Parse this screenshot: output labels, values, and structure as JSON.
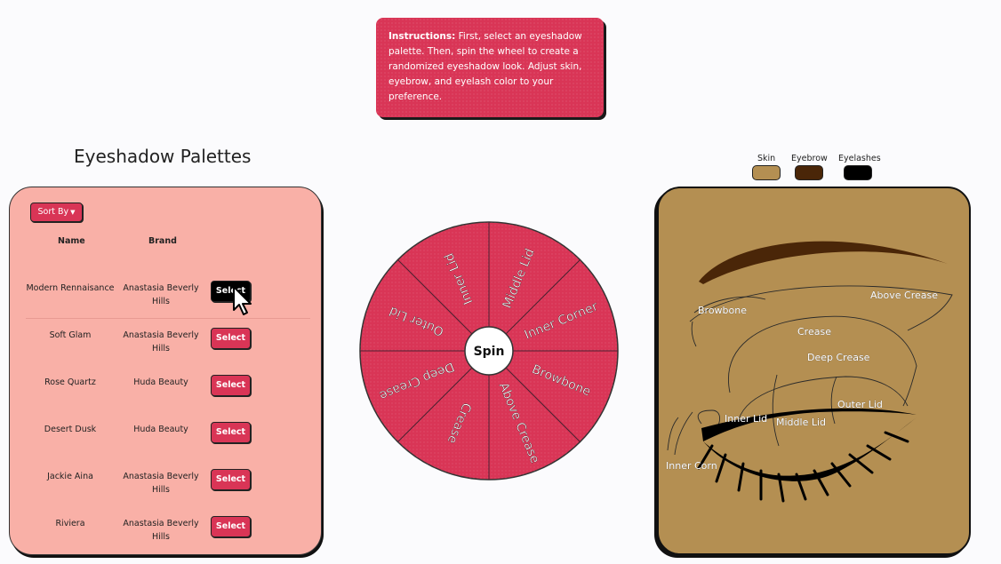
{
  "instructions": {
    "label": "Instructions:",
    "text": "First, select an eyeshadow palette. Then, spin the wheel to create a randomized eyeshadow look. Adjust skin, eyebrow, and eyelash color to your preference."
  },
  "palettes": {
    "title": "Eyeshadow Palettes",
    "sort_label": "Sort By",
    "headers": {
      "name": "Name",
      "brand": "Brand"
    },
    "select_label": "Select",
    "rows": [
      {
        "name": "Modern Rennaisance",
        "brand": "Anastasia Beverly Hills",
        "active": true
      },
      {
        "name": "Soft Glam",
        "brand": "Anastasia Beverly Hills",
        "active": false
      },
      {
        "name": "Rose Quartz",
        "brand": "Huda Beauty",
        "active": false
      },
      {
        "name": "Desert Dusk",
        "brand": "Huda Beauty",
        "active": false
      },
      {
        "name": "Jackie Aina",
        "brand": "Anastasia Beverly Hills",
        "active": false
      },
      {
        "name": "Riviera",
        "brand": "Anastasia Beverly Hills",
        "active": false
      }
    ]
  },
  "wheel": {
    "center_label": "Spin",
    "segments": [
      "Middle Lid",
      "Inner Corner",
      "Browbone",
      "Above Crease",
      "Crease",
      "Deep Crease",
      "Outer Lid",
      "Inner Lid"
    ],
    "color": "#d93556"
  },
  "colors": {
    "skin_label": "Skin",
    "eyebrow_label": "Eyebrow",
    "eyelashes_label": "Eyelashes",
    "skin": "#b48f52",
    "eyebrow": "#4a2608",
    "eyelashes": "#000000"
  },
  "eye": {
    "labels": {
      "above_crease": "Above Crease",
      "browbone": "Browbone",
      "crease": "Crease",
      "deep_crease": "Deep Crease",
      "outer_lid": "Outer Lid",
      "inner_lid": "Inner Lid",
      "middle_lid": "Middle Lid",
      "inner_corner": "Inner Corn"
    }
  }
}
